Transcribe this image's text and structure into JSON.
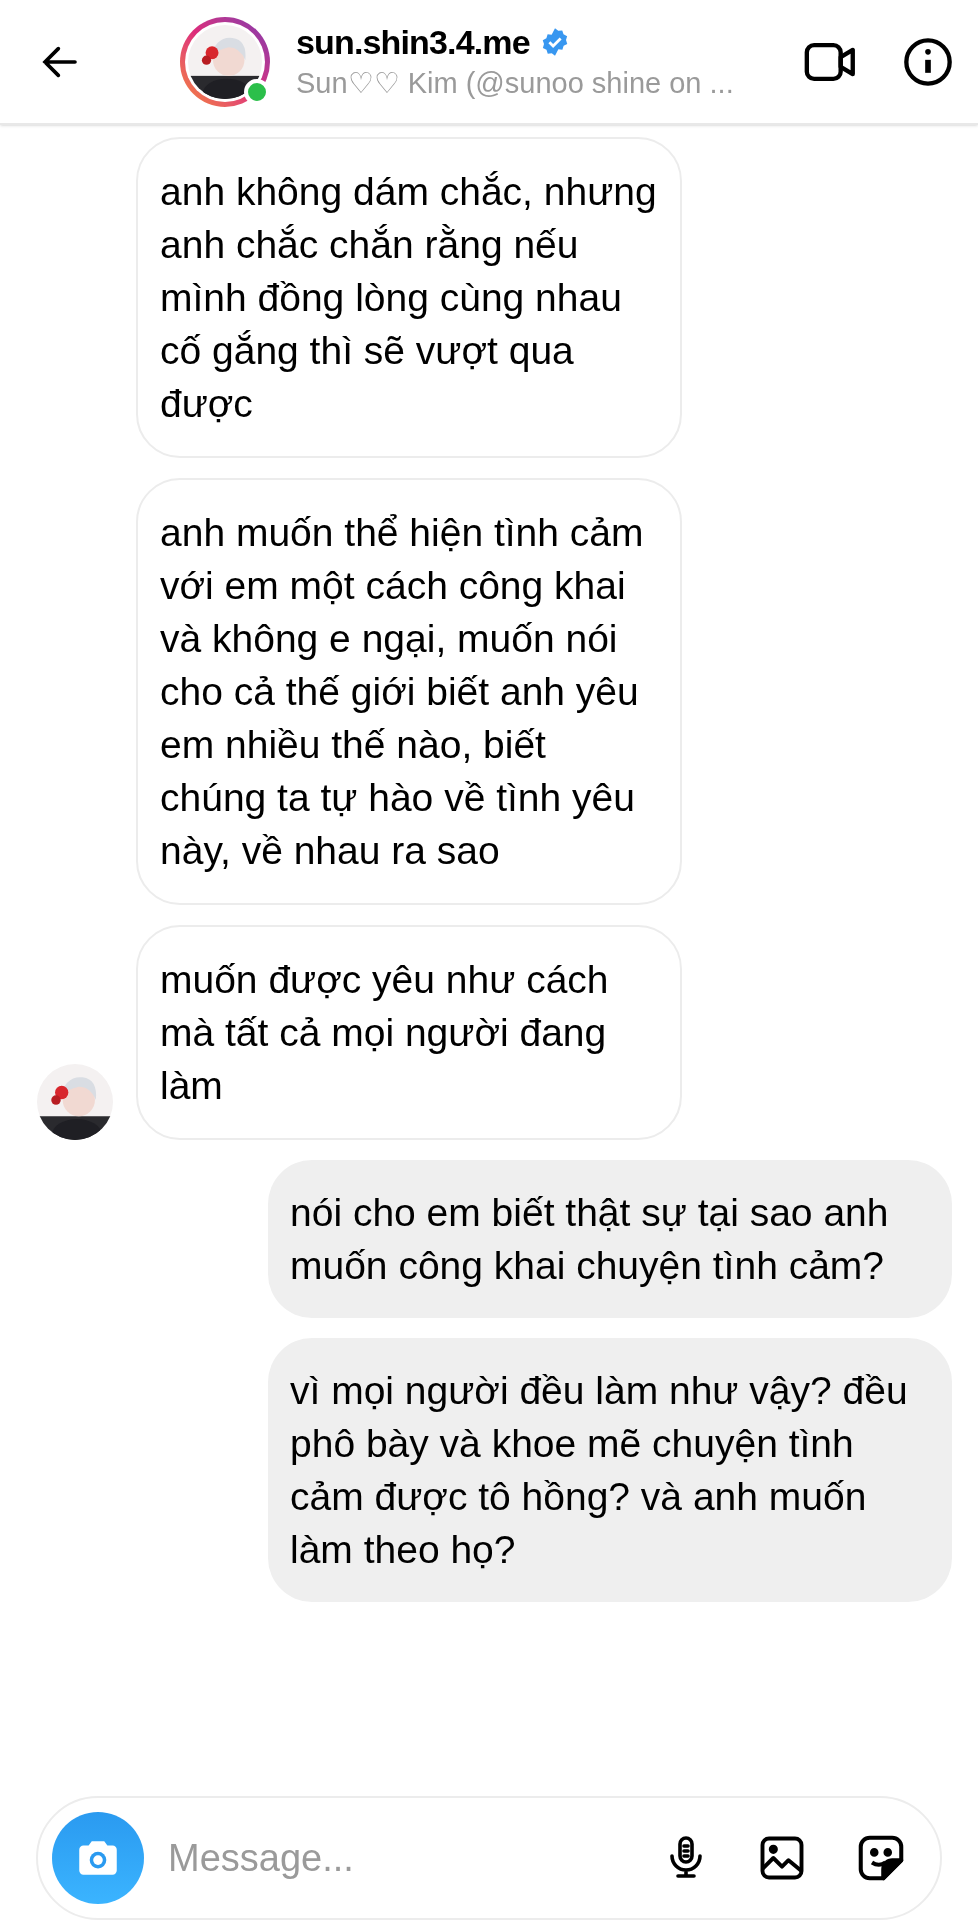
{
  "header": {
    "username": "sun.shin3.4.me",
    "verified": true,
    "online": true,
    "subtitle": "Sun♡♡ Kim (@sunoo shine on ..."
  },
  "messages": [
    {
      "kind": "them",
      "avatar": false,
      "text": "anh không dám chắc, nhưng anh chắc chắn rằng nếu mình đồng lòng cùng nhau cố gắng thì sẽ vượt qua được"
    },
    {
      "kind": "them",
      "avatar": false,
      "text": "anh muốn thể hiện tình cảm với em một cách công khai và không e ngại, muốn nói cho cả thế giới biết anh yêu em nhiều thế nào, biết chúng ta tự hào về tình yêu này, về nhau ra sao"
    },
    {
      "kind": "them",
      "avatar": true,
      "text": "muốn được yêu như cách mà tất cả mọi người đang làm"
    },
    {
      "kind": "me",
      "text": "nói cho em biết thật sự tại sao anh muốn công khai chuyện tình cảm?"
    },
    {
      "kind": "me",
      "text": "vì mọi người đều làm như vậy? đều phô bày và khoe mẽ chuyện tình cảm được tô hồng? và anh muốn làm theo họ?"
    }
  ],
  "composer": {
    "placeholder": "Message..."
  }
}
